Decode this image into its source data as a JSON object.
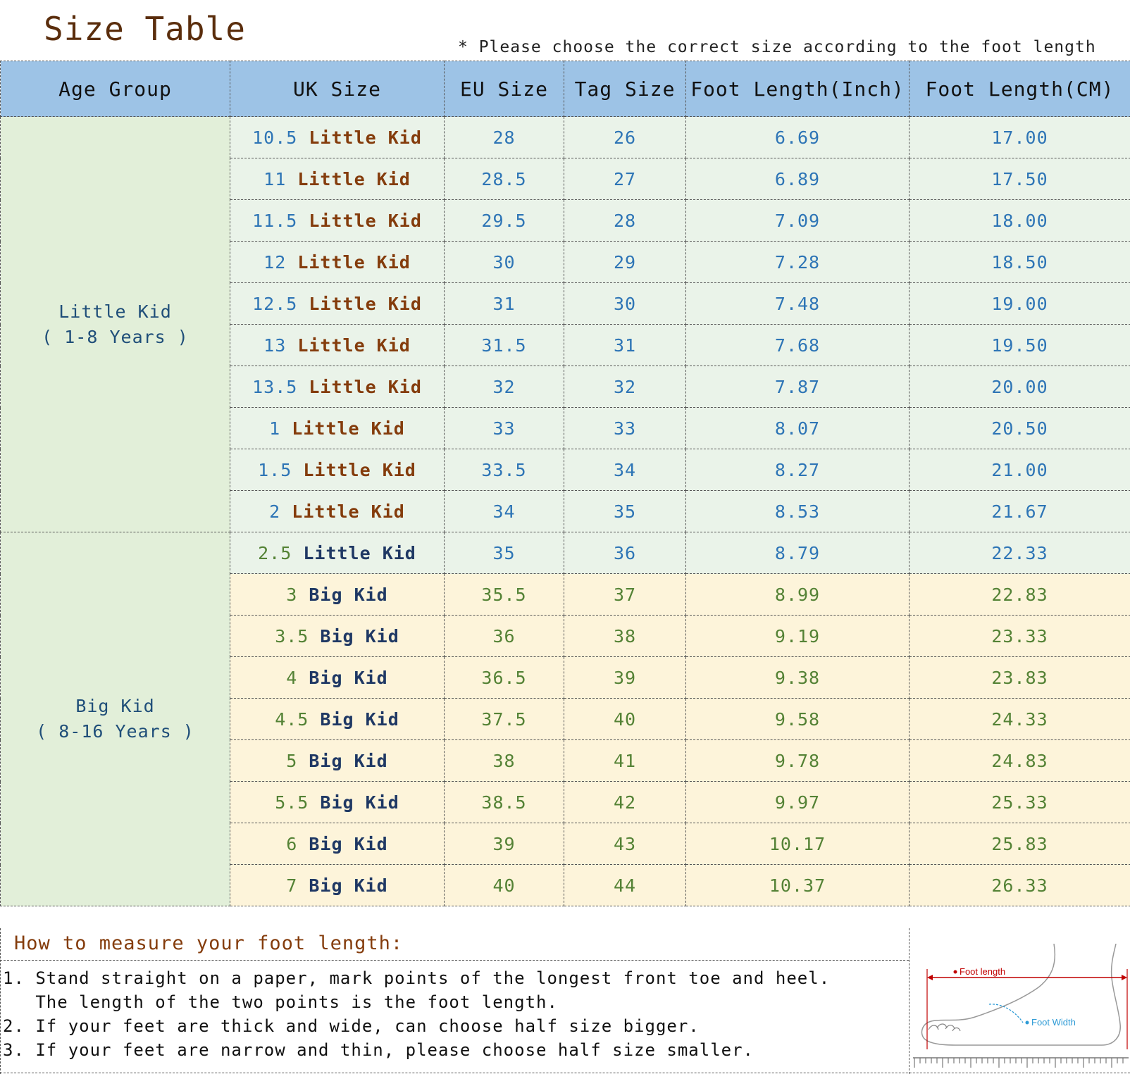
{
  "title": "Size Table",
  "note": "* Please choose the correct size according to the foot length",
  "headers": [
    "Age Group",
    "UK Size",
    "EU Size",
    "Tag Size",
    "Foot Length(Inch)",
    "Foot Length(CM)"
  ],
  "groups": [
    {
      "line1": "Little Kid",
      "line2": "( 1-8 Years )"
    },
    {
      "line1": "Big Kid",
      "line2": "( 8-16 Years )"
    }
  ],
  "rows": [
    {
      "uk_num": "10.5",
      "uk_word": "Little Kid",
      "eu": "28",
      "tag": "26",
      "inch": "6.69",
      "cm": "17.00"
    },
    {
      "uk_num": "11",
      "uk_word": "Little Kid",
      "eu": "28.5",
      "tag": "27",
      "inch": "6.89",
      "cm": "17.50"
    },
    {
      "uk_num": "11.5",
      "uk_word": "Little Kid",
      "eu": "29.5",
      "tag": "28",
      "inch": "7.09",
      "cm": "18.00"
    },
    {
      "uk_num": "12",
      "uk_word": "Little Kid",
      "eu": "30",
      "tag": "29",
      "inch": "7.28",
      "cm": "18.50"
    },
    {
      "uk_num": "12.5",
      "uk_word": "Little Kid",
      "eu": "31",
      "tag": "30",
      "inch": "7.48",
      "cm": "19.00"
    },
    {
      "uk_num": "13",
      "uk_word": "Little Kid",
      "eu": "31.5",
      "tag": "31",
      "inch": "7.68",
      "cm": "19.50"
    },
    {
      "uk_num": "13.5",
      "uk_word": "Little Kid",
      "eu": "32",
      "tag": "32",
      "inch": "7.87",
      "cm": "20.00"
    },
    {
      "uk_num": "1",
      "uk_word": "Little Kid",
      "eu": "33",
      "tag": "33",
      "inch": "8.07",
      "cm": "20.50"
    },
    {
      "uk_num": "1.5",
      "uk_word": "Little Kid",
      "eu": "33.5",
      "tag": "34",
      "inch": "8.27",
      "cm": "21.00"
    },
    {
      "uk_num": "2",
      "uk_word": "Little Kid",
      "eu": "34",
      "tag": "35",
      "inch": "8.53",
      "cm": "21.67"
    },
    {
      "uk_num": "2.5",
      "uk_word": "Little Kid",
      "eu": "35",
      "tag": "36",
      "inch": "8.79",
      "cm": "22.33"
    },
    {
      "uk_num": "3",
      "uk_word": "Big Kid",
      "eu": "35.5",
      "tag": "37",
      "inch": "8.99",
      "cm": "22.83"
    },
    {
      "uk_num": "3.5",
      "uk_word": "Big Kid",
      "eu": "36",
      "tag": "38",
      "inch": "9.19",
      "cm": "23.33"
    },
    {
      "uk_num": "4",
      "uk_word": "Big Kid",
      "eu": "36.5",
      "tag": "39",
      "inch": "9.38",
      "cm": "23.83"
    },
    {
      "uk_num": "4.5",
      "uk_word": "Big Kid",
      "eu": "37.5",
      "tag": "40",
      "inch": "9.58",
      "cm": "24.33"
    },
    {
      "uk_num": "5",
      "uk_word": "Big Kid",
      "eu": "38",
      "tag": "41",
      "inch": "9.78",
      "cm": "24.83"
    },
    {
      "uk_num": "5.5",
      "uk_word": "Big Kid",
      "eu": "38.5",
      "tag": "42",
      "inch": "9.97",
      "cm": "25.33"
    },
    {
      "uk_num": "6",
      "uk_word": "Big Kid",
      "eu": "39",
      "tag": "43",
      "inch": "10.17",
      "cm": "25.83"
    },
    {
      "uk_num": "7",
      "uk_word": "Big Kid",
      "eu": "40",
      "tag": "44",
      "inch": "10.37",
      "cm": "26.33"
    }
  ],
  "measure": {
    "title": "How to measure your foot length:",
    "steps": [
      "1. Stand straight on a paper, mark points of the longest front toe and heel.",
      "   The length of the two points is the foot length.",
      "2. If your feet are thick and wide, can choose half size bigger.",
      "3. If your feet are narrow and thin, please choose half size smaller."
    ]
  },
  "diagram": {
    "length_label": "Foot length",
    "width_label": "Foot Width",
    "icon": "foot-measure-illustration",
    "colors": {
      "length": "#c00000",
      "width": "#2e9bd6"
    }
  }
}
